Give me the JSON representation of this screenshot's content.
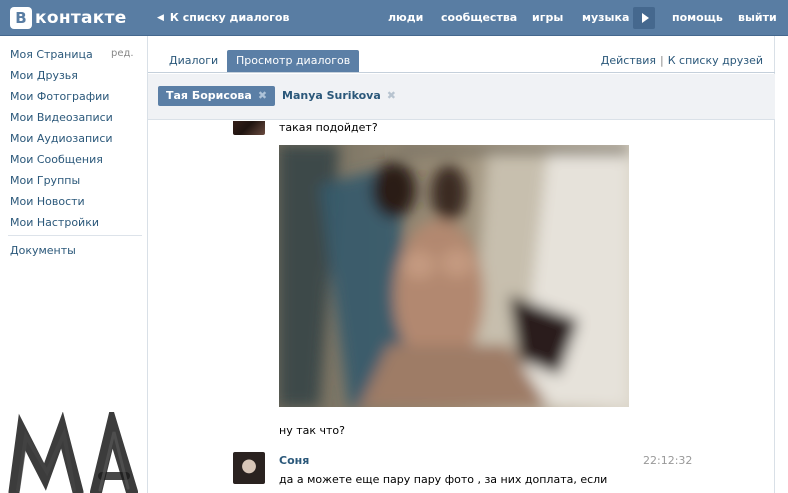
{
  "header": {
    "logo_letter": "В",
    "logo_text": "контакте",
    "back_link": "К списку диалогов",
    "nav": [
      "люди",
      "сообщества",
      "игры",
      "музыка",
      "помощь",
      "выйти"
    ]
  },
  "sidebar": {
    "edit_label": "ред.",
    "items": [
      "Моя Страница",
      "Мои Друзья",
      "Мои Фотографии",
      "Мои Видеозаписи",
      "Мои Аудиозаписи",
      "Мои Сообщения",
      "Мои Группы",
      "Мои Новости",
      "Мои Настройки"
    ],
    "extra_item": "Документы"
  },
  "tabs": {
    "dialogs": "Диалоги",
    "view_dialogs": "Просмотр диалогов"
  },
  "actions": {
    "actions_label": "Действия",
    "friends_link": "К списку друзей"
  },
  "peers": {
    "selected": "Тая Борисова",
    "other": "Manya Surikova"
  },
  "messages": {
    "m1_text": "такая подойдет?",
    "m2_text": "ну так что?",
    "m3_author": "Соня",
    "m3_time": "22:12:32",
    "m3_text": "да а можете еще пару пару фото , за них доплата, если"
  },
  "colors": {
    "header_bg": "#597da3",
    "link": "#2b587a",
    "active_tab": "#5b7fa6"
  }
}
